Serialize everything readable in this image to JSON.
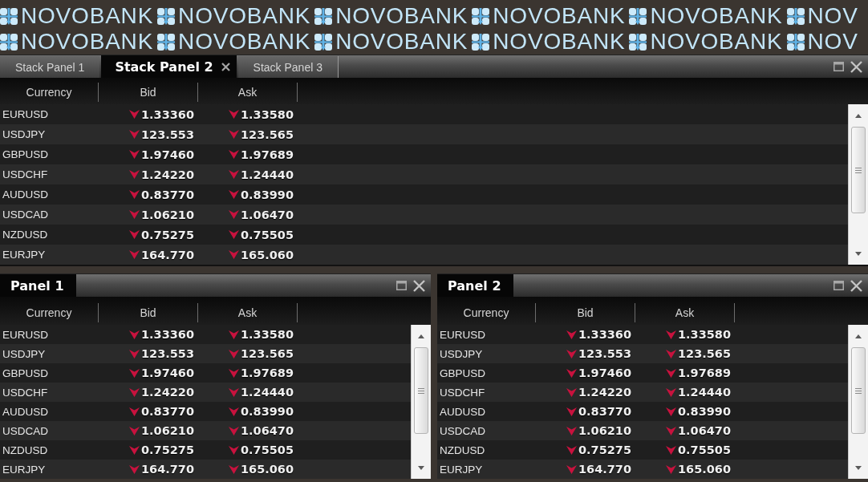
{
  "banner": {
    "rows": [
      {
        "words": [
          "NOVOBANK",
          "NOVOBANK",
          "NOVOBANK",
          "NOVOBANK",
          "NOVOBANK",
          "NOV"
        ]
      },
      {
        "words": [
          "NOVOBANK",
          "NOVOBANK",
          "NOVOBANK",
          "NOVOBANK",
          "NOVOBANK",
          "NOV"
        ]
      }
    ]
  },
  "stack_tabs": [
    {
      "label": "Stack Panel 1",
      "selected": false
    },
    {
      "label": "Stack Panel 2",
      "selected": true
    },
    {
      "label": "Stack Panel 3",
      "selected": false
    }
  ],
  "stack_panel": {
    "columns": [
      "Currency",
      "Bid",
      "Ask"
    ],
    "rows": [
      {
        "currency": "EURUSD",
        "bid": {
          "value": "1.33360",
          "falling": true
        },
        "ask": {
          "value": "1.33580",
          "falling": true
        }
      },
      {
        "currency": "USDJPY",
        "bid": {
          "value": "123.553",
          "falling": true
        },
        "ask": {
          "value": "123.565",
          "falling": true
        }
      },
      {
        "currency": "GBPUSD",
        "bid": {
          "value": "1.97460",
          "falling": true
        },
        "ask": {
          "value": "1.97689",
          "falling": true
        }
      },
      {
        "currency": "USDCHF",
        "bid": {
          "value": "1.24220",
          "falling": true
        },
        "ask": {
          "value": "1.24440",
          "falling": true
        }
      },
      {
        "currency": "AUDUSD",
        "bid": {
          "value": "0.83770",
          "falling": true
        },
        "ask": {
          "value": "0.83990",
          "falling": true
        }
      },
      {
        "currency": "USDCAD",
        "bid": {
          "value": "1.06210",
          "falling": true
        },
        "ask": {
          "value": "1.06470",
          "falling": true
        }
      },
      {
        "currency": "NZDUSD",
        "bid": {
          "value": "0.75275",
          "falling": true
        },
        "ask": {
          "value": "0.75505",
          "falling": true
        }
      },
      {
        "currency": "EURJPY",
        "bid": {
          "value": "164.770",
          "falling": true
        },
        "ask": {
          "value": "165.060",
          "falling": true
        }
      }
    ]
  },
  "panels": [
    {
      "title": "Panel 1",
      "columns": [
        "Currency",
        "Bid",
        "Ask"
      ],
      "rows": [
        {
          "currency": "EURUSD",
          "bid": {
            "value": "1.33360",
            "falling": true
          },
          "ask": {
            "value": "1.33580",
            "falling": true
          }
        },
        {
          "currency": "USDJPY",
          "bid": {
            "value": "123.553",
            "falling": true
          },
          "ask": {
            "value": "123.565",
            "falling": true
          }
        },
        {
          "currency": "GBPUSD",
          "bid": {
            "value": "1.97460",
            "falling": true
          },
          "ask": {
            "value": "1.97689",
            "falling": true
          }
        },
        {
          "currency": "USDCHF",
          "bid": {
            "value": "1.24220",
            "falling": true
          },
          "ask": {
            "value": "1.24440",
            "falling": true
          }
        },
        {
          "currency": "AUDUSD",
          "bid": {
            "value": "0.83770",
            "falling": true
          },
          "ask": {
            "value": "0.83990",
            "falling": true
          }
        },
        {
          "currency": "USDCAD",
          "bid": {
            "value": "1.06210",
            "falling": true
          },
          "ask": {
            "value": "1.06470",
            "falling": true
          }
        },
        {
          "currency": "NZDUSD",
          "bid": {
            "value": "0.75275",
            "falling": true
          },
          "ask": {
            "value": "0.75505",
            "falling": true
          }
        },
        {
          "currency": "EURJPY",
          "bid": {
            "value": "164.770",
            "falling": true
          },
          "ask": {
            "value": "165.060",
            "falling": true
          }
        }
      ]
    },
    {
      "title": "Panel 2",
      "columns": [
        "Currency",
        "Bid",
        "Ask"
      ],
      "rows": [
        {
          "currency": "EURUSD",
          "bid": {
            "value": "1.33360",
            "falling": true
          },
          "ask": {
            "value": "1.33580",
            "falling": true
          }
        },
        {
          "currency": "USDJPY",
          "bid": {
            "value": "123.553",
            "falling": true
          },
          "ask": {
            "value": "123.565",
            "falling": true
          }
        },
        {
          "currency": "GBPUSD",
          "bid": {
            "value": "1.97460",
            "falling": true
          },
          "ask": {
            "value": "1.97689",
            "falling": true
          }
        },
        {
          "currency": "USDCHF",
          "bid": {
            "value": "1.24220",
            "falling": true
          },
          "ask": {
            "value": "1.24440",
            "falling": true
          }
        },
        {
          "currency": "AUDUSD",
          "bid": {
            "value": "0.83770",
            "falling": true
          },
          "ask": {
            "value": "0.83990",
            "falling": true
          }
        },
        {
          "currency": "USDCAD",
          "bid": {
            "value": "1.06210",
            "falling": true
          },
          "ask": {
            "value": "1.06470",
            "falling": true
          }
        },
        {
          "currency": "NZDUSD",
          "bid": {
            "value": "0.75275",
            "falling": true
          },
          "ask": {
            "value": "0.75505",
            "falling": true
          }
        },
        {
          "currency": "EURJPY",
          "bid": {
            "value": "164.770",
            "falling": true
          },
          "ask": {
            "value": "165.060",
            "falling": true
          }
        }
      ]
    }
  ]
}
